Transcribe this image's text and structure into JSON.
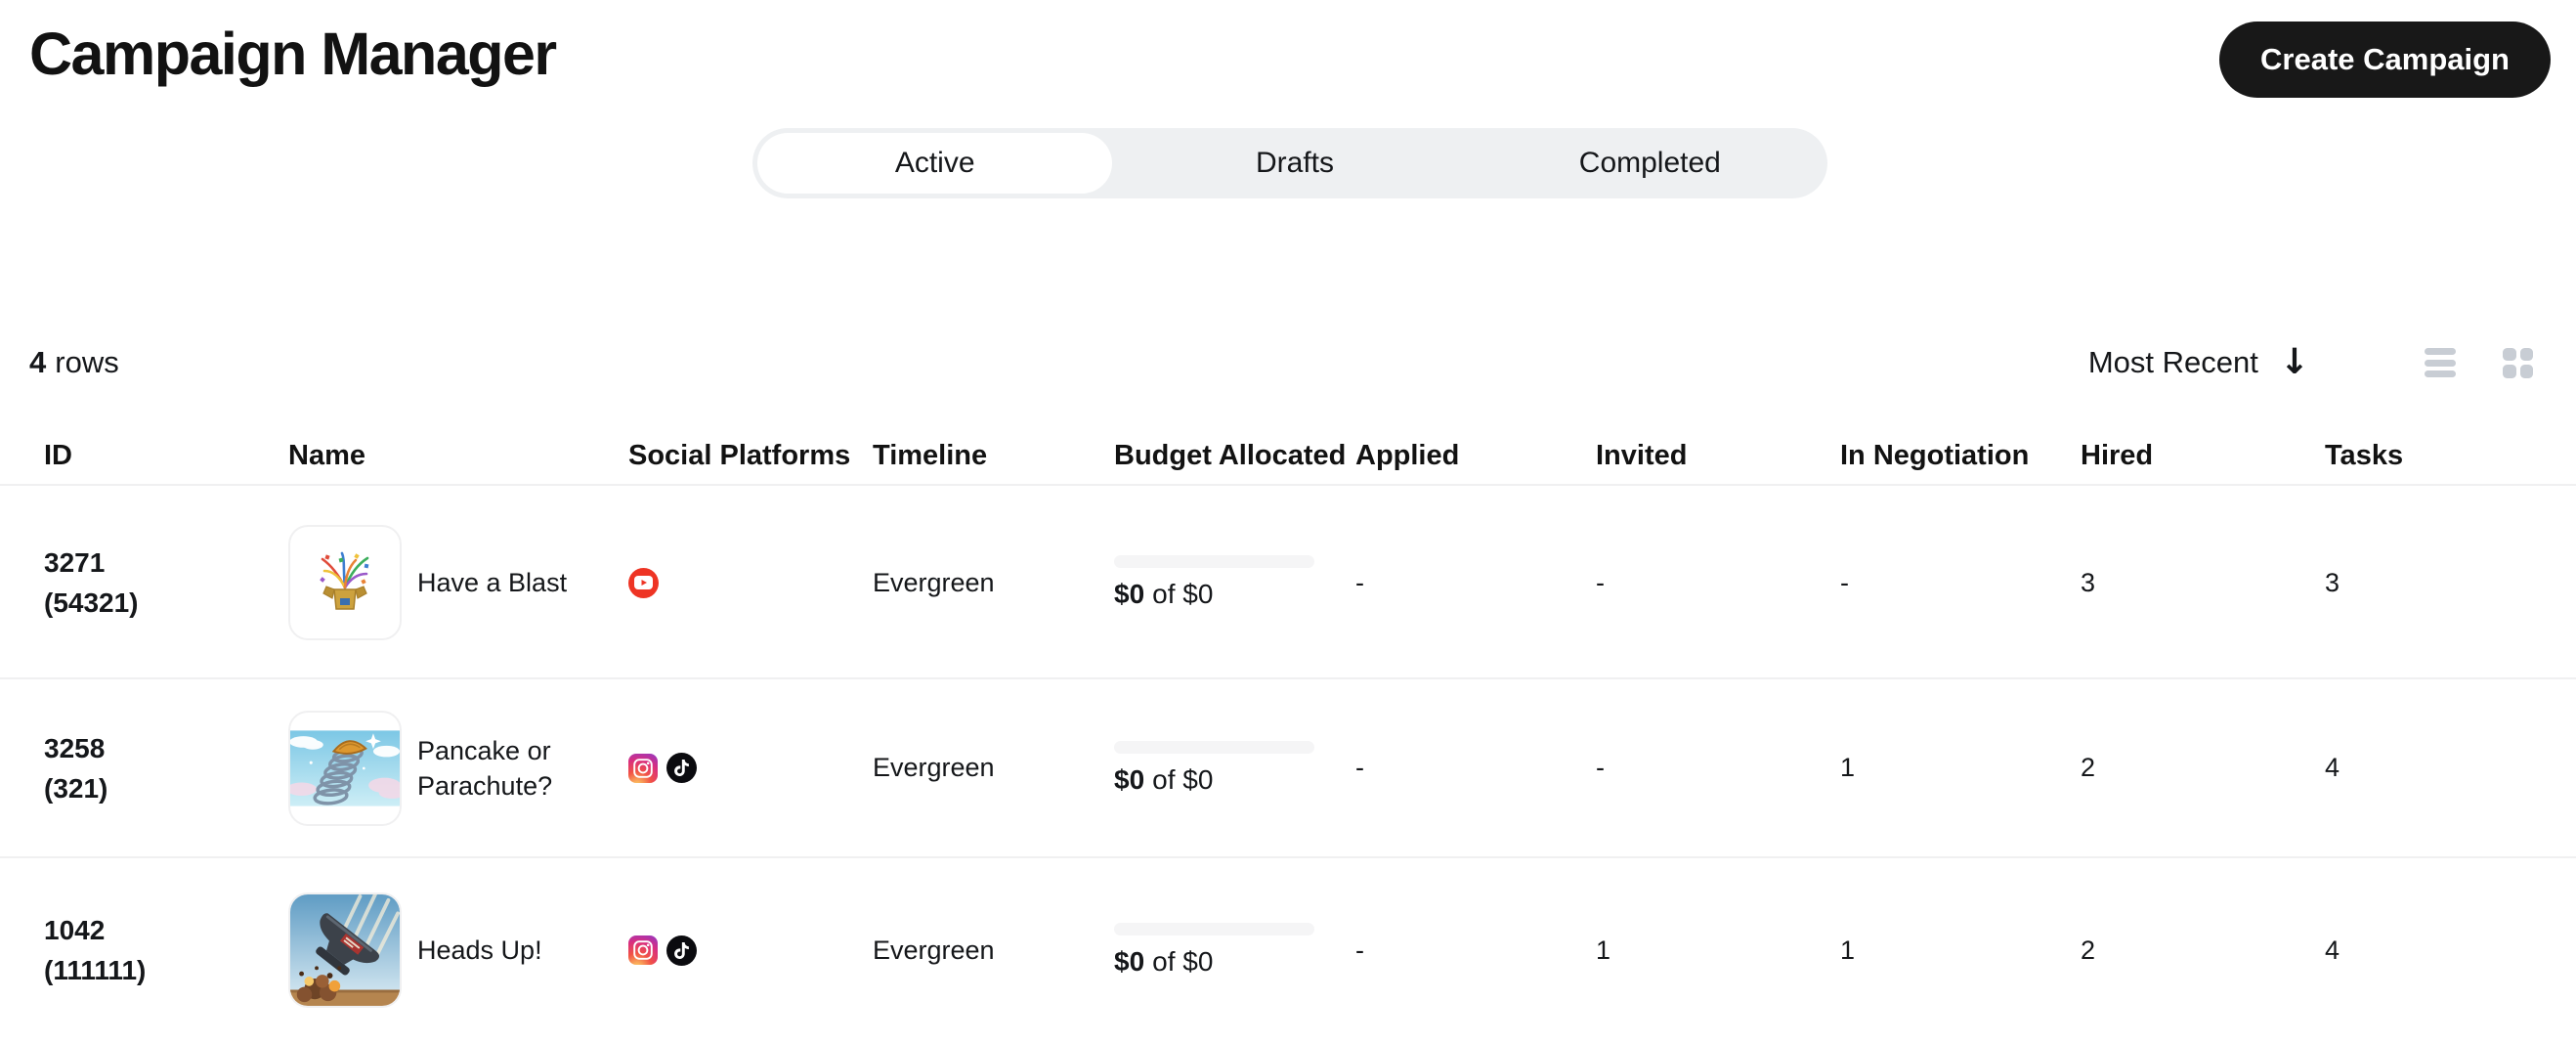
{
  "header": {
    "title": "Campaign Manager",
    "create_button_label": "Create Campaign"
  },
  "tabs": {
    "items": [
      {
        "label": "Active"
      },
      {
        "label": "Drafts"
      },
      {
        "label": "Completed"
      }
    ],
    "active_tab": "Active"
  },
  "toolbar": {
    "row_count": "4",
    "row_count_label": "rows",
    "sort": {
      "label": "Most Recent",
      "arrow": "↓",
      "direction": "descending"
    },
    "view_modes": [
      "list-view",
      "grid-view"
    ]
  },
  "table": {
    "columns": [
      "ID",
      "Name",
      "Social Platforms",
      "Timeline",
      "Budget Allocated",
      "Applied",
      "Invited",
      "In Negotiation",
      "Hired",
      "Tasks"
    ],
    "rows": [
      {
        "id": "3271",
        "id_secondary": "(54321)",
        "name": "Have a Blast",
        "thumbnail": "confetti-box-illustration",
        "platforms": [
          "YouTube"
        ],
        "timeline": "Evergreen",
        "budget": {
          "spent": "$0",
          "of_label": "of $0",
          "progress_percent": 0
        },
        "applied": "-",
        "invited": "-",
        "in_negotiation": "-",
        "hired": "3",
        "tasks": "3"
      },
      {
        "id": "3258",
        "id_secondary": "(321)",
        "name": "Pancake or Parachute?",
        "thumbnail": "spring-pancake-sky-illustration",
        "platforms": [
          "Instagram",
          "TikTok"
        ],
        "timeline": "Evergreen",
        "budget": {
          "spent": "$0",
          "of_label": "of $0",
          "progress_percent": 0
        },
        "applied": "-",
        "invited": "-",
        "in_negotiation": "1",
        "hired": "2",
        "tasks": "4"
      },
      {
        "id": "1042",
        "id_secondary": "(111111)",
        "name": "Heads Up!",
        "thumbnail": "falling-anvil-crash-illustration",
        "platforms": [
          "Instagram",
          "TikTok"
        ],
        "timeline": "Evergreen",
        "budget": {
          "spent": "$0",
          "of_label": "of $0",
          "progress_percent": 0
        },
        "applied": "-",
        "invited": "1",
        "in_negotiation": "1",
        "hired": "2",
        "tasks": "4"
      }
    ]
  },
  "colors": {
    "accent_button": "#181818",
    "tab_bar_bg": "#eef0f2",
    "divider": "#f0f0f1",
    "progress_track": "#f5f5f6",
    "view_icon_gray": "#c8cdd4",
    "youtube_red": "#ee3424",
    "tiktok_black": "#0b0b0f"
  }
}
